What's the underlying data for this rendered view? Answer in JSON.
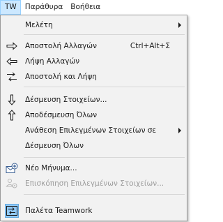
{
  "menubar": {
    "items": [
      {
        "label": "TW"
      },
      {
        "label": "Παράθυρα"
      },
      {
        "label": "Βοήθεια"
      }
    ]
  },
  "menu": {
    "study": "Μελέτη",
    "send_changes": "Αποστολή Αλλαγών",
    "send_changes_shortcut": "Ctrl+Alt+Σ",
    "receive_changes": "Λήψη Αλλαγών",
    "send_and_receive": "Αποστολή και Λήψη",
    "reserve_elements": "Δέσμευση Στοιχείων...",
    "release_all": "Αποδέσμευση Όλων",
    "assign_selected": "Ανάθεση Επιλεγμένων Στοιχείων σε",
    "reserve_all": "Δέσμευση Όλων",
    "new_message": "Νέο Μήνυμα...",
    "review_selected": "Επισκόπηση Επιλεγμένων Στοιχείων...",
    "teamwork_palette": "Παλέτα Teamwork"
  },
  "icons": {
    "send": "arrow-right-icon",
    "receive": "arrow-left-icon",
    "send_receive": "arrows-swap-icon",
    "reserve": "arrow-down-icon",
    "release": "arrow-up-icon",
    "new_message": "envelope-add-icon",
    "review": "users-gear-icon",
    "palette": "teamwork-palette-icon"
  }
}
